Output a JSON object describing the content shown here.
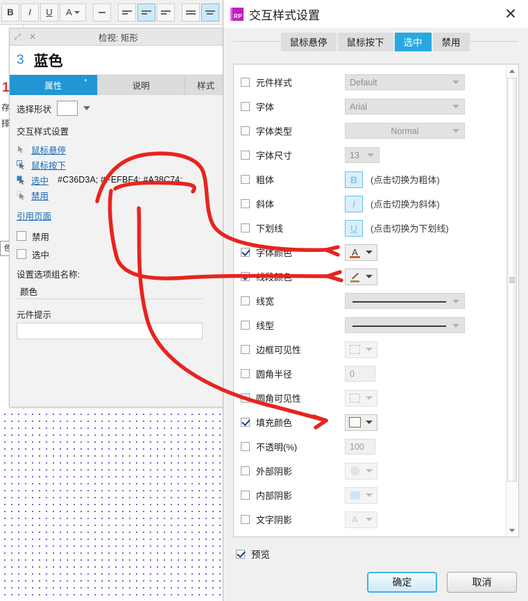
{
  "toolbar": {
    "buttons": [
      {
        "name": "bold",
        "label": "B"
      },
      {
        "name": "italic",
        "label": "I"
      },
      {
        "name": "underline",
        "label": "U"
      },
      {
        "name": "font-color",
        "label": "A"
      }
    ]
  },
  "bleed": {
    "number": "1",
    "char1": "存",
    "char2": "择",
    "swatch_char": "色"
  },
  "inspector": {
    "title": "检视: 矩形",
    "restore_icon": "restore-icon",
    "close_icon": "close-icon",
    "item_number": "3",
    "item_name": "蓝色",
    "tabs": [
      {
        "label": "属性",
        "star": "*",
        "active": true
      },
      {
        "label": "说明",
        "star": "",
        "active": false
      },
      {
        "label": "样式",
        "star": "",
        "active": false
      }
    ],
    "shape_label": "选择形状",
    "section_title": "交互样式设置",
    "states": [
      {
        "label": "鼠标悬停",
        "values": ""
      },
      {
        "label": "鼠标按下",
        "values": ""
      },
      {
        "label": "选中",
        "values": "#C36D3A; #FEFBF4; #A38C74;"
      },
      {
        "label": "禁用",
        "values": ""
      }
    ],
    "reference_page_link": "引用页面",
    "checkboxes": [
      {
        "label": "禁用",
        "checked": false
      },
      {
        "label": "选中",
        "checked": false
      }
    ],
    "group_name_label": "设置选项组名称:",
    "group_name_value": "颜色",
    "tooltip_label": "元件提示",
    "tooltip_value": ""
  },
  "dialog": {
    "title": "交互样式设置",
    "logo_text": "RP",
    "close_icon": "close-icon",
    "tabs": [
      {
        "label": "鼠标悬停",
        "active": false
      },
      {
        "label": "鼠标按下",
        "active": false
      },
      {
        "label": "选中",
        "active": true
      },
      {
        "label": "禁用",
        "active": false
      }
    ],
    "rows": [
      {
        "label": "元件样式",
        "checked": false,
        "control": "select",
        "value": "Default",
        "hint": ""
      },
      {
        "label": "字体",
        "checked": false,
        "control": "select",
        "value": "Arial",
        "hint": ""
      },
      {
        "label": "字体类型",
        "checked": false,
        "control": "select",
        "value": "Normal",
        "hint": ""
      },
      {
        "label": "字体尺寸",
        "checked": false,
        "control": "select-small",
        "value": "13",
        "hint": ""
      },
      {
        "label": "粗体",
        "checked": false,
        "control": "format",
        "value": "B",
        "hint": "(点击切换为粗体)"
      },
      {
        "label": "斜体",
        "checked": false,
        "control": "format-i",
        "value": "I",
        "hint": "(点击切换为斜体)"
      },
      {
        "label": "下划线",
        "checked": false,
        "control": "format-u",
        "value": "U",
        "hint": "(点击切换为下划线)"
      },
      {
        "label": "字体颜色",
        "checked": true,
        "control": "color-font",
        "value": "",
        "hint": ""
      },
      {
        "label": "线段颜色",
        "checked": true,
        "control": "color-line",
        "value": "",
        "hint": ""
      },
      {
        "label": "线宽",
        "checked": false,
        "control": "line-preview",
        "value": "",
        "hint": ""
      },
      {
        "label": "线型",
        "checked": false,
        "control": "line-preview",
        "value": "",
        "hint": ""
      },
      {
        "label": "边框可见性",
        "checked": false,
        "control": "swatch-border",
        "value": "",
        "hint": ""
      },
      {
        "label": "圆角半径",
        "checked": false,
        "control": "text",
        "value": "0",
        "hint": ""
      },
      {
        "label": "圆角可见性",
        "checked": false,
        "control": "swatch-corner",
        "value": "",
        "hint": ""
      },
      {
        "label": "填充颜色",
        "checked": true,
        "control": "color-fill",
        "value": "",
        "hint": ""
      },
      {
        "label": "不透明(%)",
        "checked": false,
        "control": "text",
        "value": "100",
        "hint": ""
      },
      {
        "label": "外部阴影",
        "checked": false,
        "control": "swatch-outer-shadow",
        "value": "",
        "hint": ""
      },
      {
        "label": "内部阴影",
        "checked": false,
        "control": "swatch-inner-shadow",
        "value": "",
        "hint": ""
      },
      {
        "label": "文字阴影",
        "checked": false,
        "control": "swatch-text-shadow",
        "value": "",
        "hint": ""
      }
    ],
    "preview_label": "预览",
    "preview_checked": true,
    "ok_label": "确定",
    "cancel_label": "取消"
  },
  "colors": {
    "accent_blue": "#29a8e0",
    "tab_active": "#2196d3",
    "annotation_red": "#e8241f",
    "font_color_swatch": "#C36D3A",
    "fill_color_swatch": "#FEFBF4",
    "line_color_swatch": "#A38C74"
  },
  "annotations": {
    "arrow_font_color": "arrow-to-font-color",
    "arrow_line_color": "arrow-to-line-color",
    "arrow_fill_color": "arrow-to-fill-color"
  }
}
